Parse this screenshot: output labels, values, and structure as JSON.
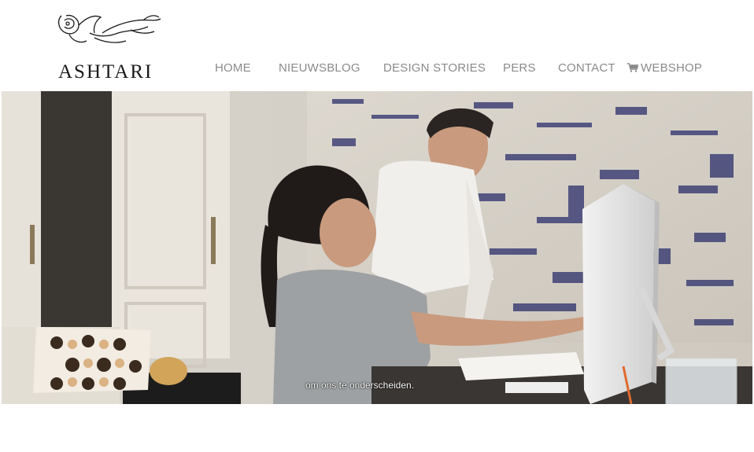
{
  "brand": {
    "name": "ASHTARI",
    "logo_icon": "ornament-icon"
  },
  "nav": {
    "items": [
      {
        "label": "HOME"
      },
      {
        "label": "NIEUWSBLOG"
      },
      {
        "label": "DESIGN STORIES"
      },
      {
        "label": "PERS"
      },
      {
        "label": "CONTACT"
      },
      {
        "label": "WEBSHOP",
        "icon": "cart-icon"
      }
    ]
  },
  "hero": {
    "subtitle": "om ons te onderscheiden."
  },
  "colors": {
    "nav_text": "#8a8a8a",
    "logo_text": "#1a1a1a",
    "carpet_ink": "#2b2f6b"
  }
}
